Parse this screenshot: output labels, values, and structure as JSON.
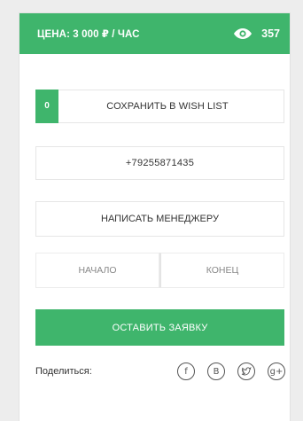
{
  "header": {
    "price": "ЦЕНА: 3 000 ₽ / ЧАС",
    "views": "357",
    "icon": "eye-icon"
  },
  "wishlist": {
    "count": "0",
    "label": "СОХРАНИТЬ В WISH LIST"
  },
  "phone": "+79255871435",
  "manager_button": "НАПИСАТЬ МЕНЕДЖЕРУ",
  "time": {
    "start": "НАЧАЛО",
    "end": "КОНЕЦ"
  },
  "submit_button": "ОСТАВИТЬ ЗАЯВКУ",
  "share": {
    "label": "Поделиться:",
    "networks": [
      {
        "icon": "facebook-icon",
        "glyph": "f"
      },
      {
        "icon": "vk-icon",
        "glyph": "B"
      },
      {
        "icon": "twitter-icon",
        "glyph": ""
      },
      {
        "icon": "google-plus-icon",
        "glyph": "g+"
      }
    ]
  },
  "colors": {
    "accent": "#3fb56c",
    "background": "#ededed"
  }
}
